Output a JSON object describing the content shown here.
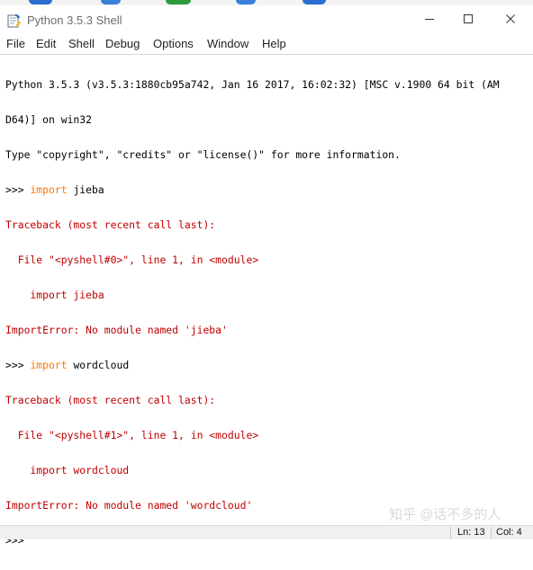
{
  "window": {
    "title": "Python 3.5.3 Shell",
    "minimize_label": "—",
    "maximize_label": "☐",
    "close_label": "✕"
  },
  "menu": [
    "File",
    "Edit",
    "Shell",
    "Debug",
    "Options",
    "Window",
    "Help"
  ],
  "shell": {
    "lines": [
      {
        "type": "output",
        "text": "Python 3.5.3 (v3.5.3:1880cb95a742, Jan 16 2017, 16:02:32) [MSC v.1900 64 bit (AM"
      },
      {
        "type": "output",
        "text": "D64)] on win32"
      },
      {
        "type": "output",
        "text": "Type \"copyright\", \"credits\" or \"license()\" for more information."
      },
      {
        "type": "input",
        "prompt": ">>> ",
        "keyword": "import",
        "rest": " jieba"
      },
      {
        "type": "error",
        "text": "Traceback (most recent call last):"
      },
      {
        "type": "error",
        "text": "  File \"<pyshell#0>\", line 1, in <module>"
      },
      {
        "type": "error",
        "text": "    import jieba"
      },
      {
        "type": "error",
        "text": "ImportError: No module named 'jieba'"
      },
      {
        "type": "input",
        "prompt": ">>> ",
        "keyword": "import",
        "rest": " wordcloud"
      },
      {
        "type": "error",
        "text": "Traceback (most recent call last):"
      },
      {
        "type": "error",
        "text": "  File \"<pyshell#1>\", line 1, in <module>"
      },
      {
        "type": "error",
        "text": "    import wordcloud"
      },
      {
        "type": "error",
        "text": "ImportError: No module named 'wordcloud'"
      },
      {
        "type": "prompt",
        "prompt": ">>> "
      }
    ]
  },
  "watermark": "知乎 @话不多的人",
  "status": {
    "line": "Ln: 13",
    "col": "Col: 4"
  },
  "colors": {
    "keyword": "#ff7700",
    "error": "#c00000",
    "text": "#000000"
  }
}
